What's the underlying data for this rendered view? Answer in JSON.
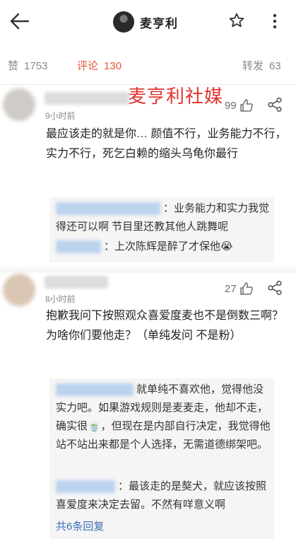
{
  "header": {
    "title": "麦亨利",
    "back_icon": "arrow-left-icon",
    "favorite_icon": "star-icon",
    "more_icon": "more-vertical-icon"
  },
  "tabs": {
    "likes": {
      "label": "赞",
      "count": "1753"
    },
    "comments": {
      "label": "评论",
      "count": "130"
    },
    "reposts": {
      "label": "转发",
      "count": "63"
    }
  },
  "watermark": "麦亨利社媒",
  "comments": [
    {
      "time": "9小时前",
      "likes": "99",
      "text": "最应该走的就是你… 颜值不行，业务能力不行，实力不行，死乞白赖的缩头乌龟你最行",
      "replies": [
        {
          "text": "：业务能力和实力我觉得还可以啊 节目里还教其他人跳舞呢"
        },
        {
          "text": "：上次陈辉是醉了才保他😭"
        }
      ]
    },
    {
      "time": "8小时前",
      "likes": "27",
      "text": "抱歉我问下按照观众喜爱度麦也不是倒数三啊？为啥你们要他走？（单纯发问 不是粉）",
      "replies": [
        {
          "text": "就单纯不喜欢他，觉得他没实力吧。如果游戏规则是麦麦走，他却不走，确实很🍵，但现在是内部自行决定，我觉得他站不站出来都是个人选择，无需道德绑架吧。"
        },
        {
          "text": "：最该走的是獒犬，就应该按照喜爱度来决定去留。不然有咩意义啊"
        }
      ],
      "more_replies": "共6条回复"
    }
  ],
  "colors": {
    "accent": "#e8553f",
    "watermark": "#e0322b",
    "link": "#3b6fb6"
  }
}
